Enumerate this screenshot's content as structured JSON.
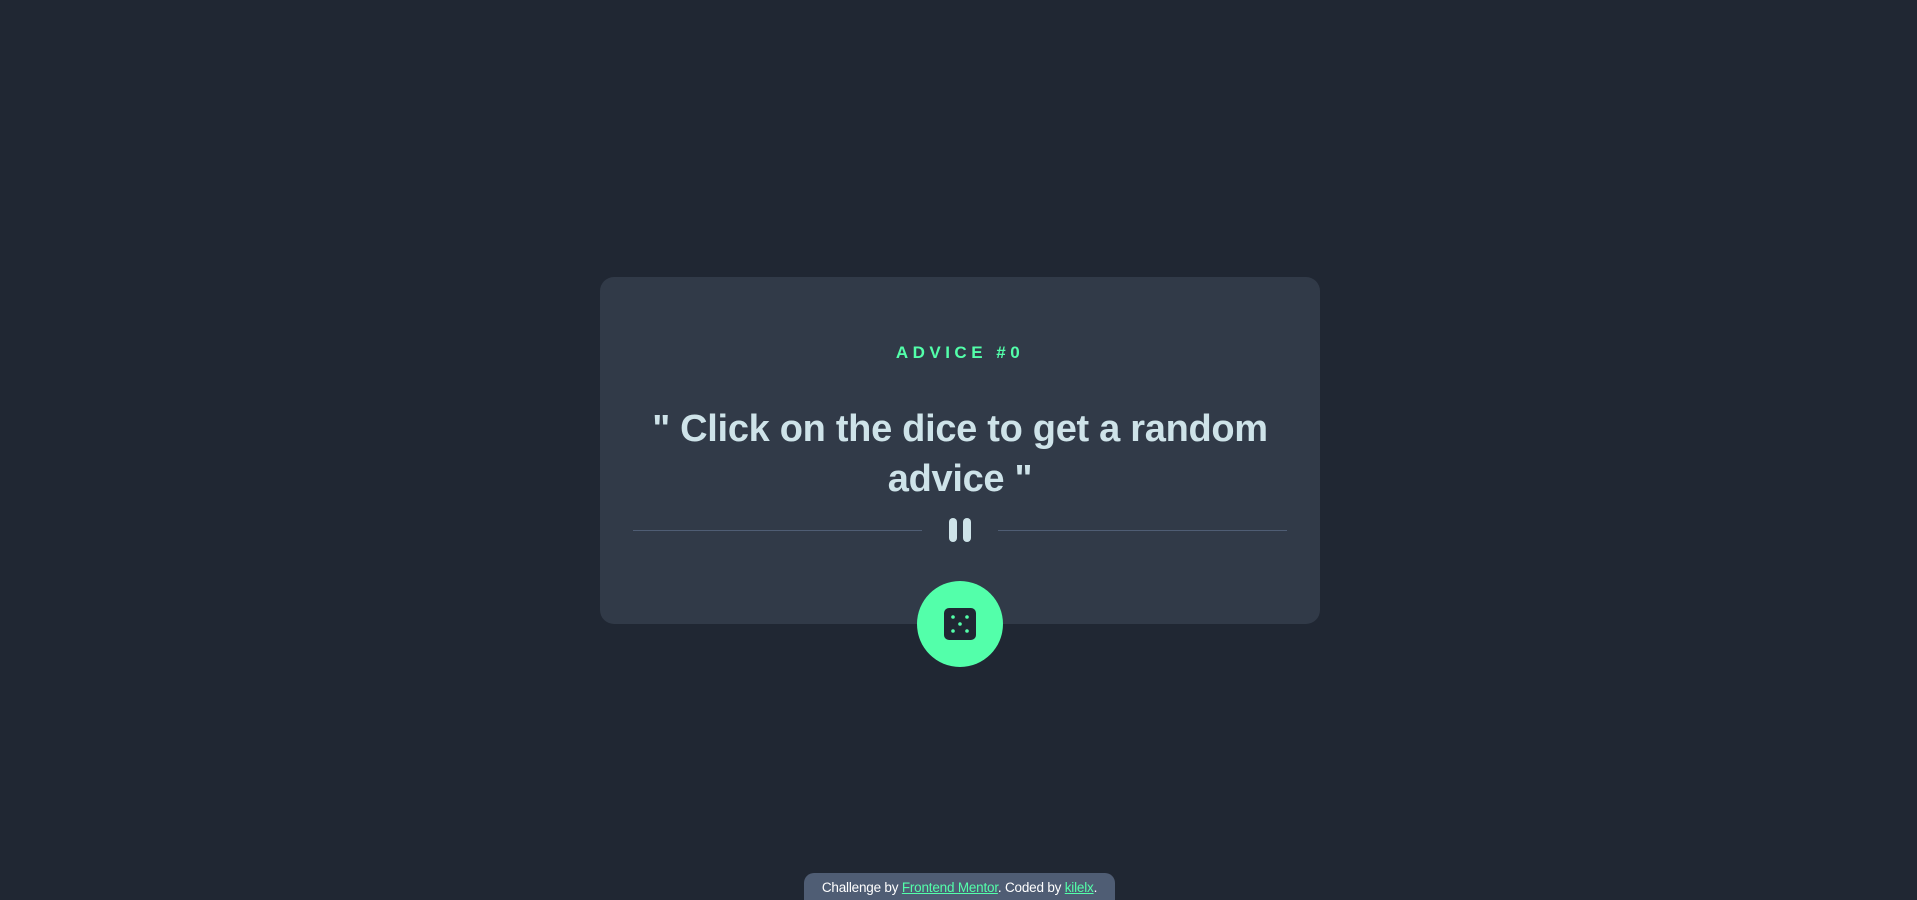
{
  "card": {
    "advice_id": "ADVICE #0",
    "advice_text": "\" Click on the dice to get a random advice \""
  },
  "divider": {
    "icon": "pause-quote-icon"
  },
  "dice_button": {
    "icon": "dice-icon"
  },
  "attribution": {
    "prefix": "Challenge by ",
    "challenge_link": "Frontend Mentor",
    "middle": ". Coded by ",
    "author_link": "kilelx",
    "suffix": "."
  },
  "colors": {
    "background": "#202733",
    "card": "#313a48",
    "accent": "#53ffaa",
    "text": "#cee3e9",
    "divider": "#4f5d74"
  }
}
